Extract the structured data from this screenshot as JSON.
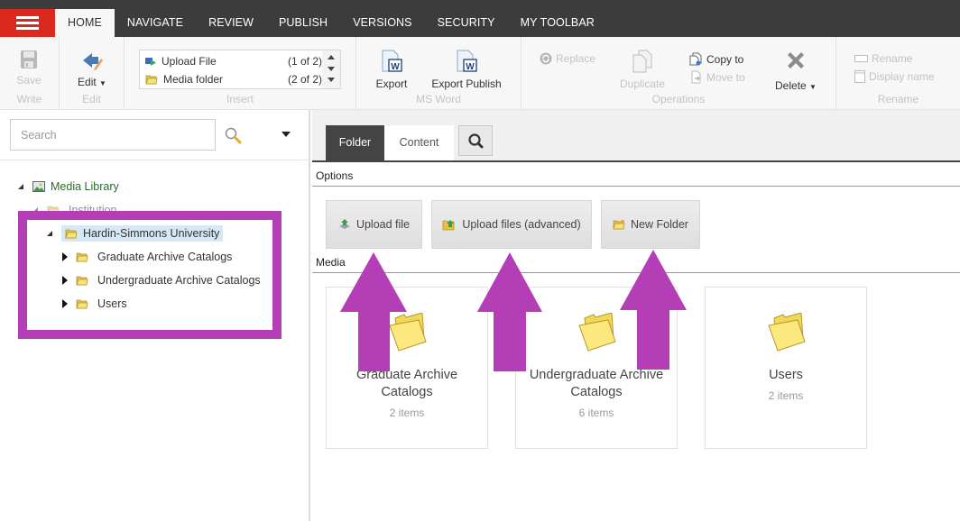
{
  "topbar": {
    "menu_icon": "hamburger-menu-icon",
    "tabs": [
      {
        "label": "HOME",
        "active": true
      },
      {
        "label": "NAVIGATE",
        "active": false
      },
      {
        "label": "REVIEW",
        "active": false
      },
      {
        "label": "PUBLISH",
        "active": false
      },
      {
        "label": "VERSIONS",
        "active": false
      },
      {
        "label": "SECURITY",
        "active": false
      },
      {
        "label": "MY TOOLBAR",
        "active": false
      }
    ]
  },
  "ribbon": {
    "write": {
      "group_label": "Write",
      "save_label": "Save"
    },
    "edit": {
      "group_label": "Edit",
      "edit_label": "Edit"
    },
    "insert": {
      "group_label": "Insert",
      "items": [
        {
          "label": "Upload File",
          "count": "(1 of 2)",
          "icon": "upload-file-icon"
        },
        {
          "label": "Media folder",
          "count": "(2 of 2)",
          "icon": "folder-icon"
        }
      ]
    },
    "msword": {
      "group_label": "MS Word",
      "export_label": "Export",
      "export_publish_label": "Export Publish"
    },
    "operations": {
      "group_label": "Operations",
      "replace_label": "Replace",
      "duplicate_label": "Duplicate",
      "copy_to_label": "Copy to",
      "move_to_label": "Move to",
      "delete_label": "Delete"
    },
    "rename": {
      "group_label": "Rename",
      "rename_label": "Rename",
      "display_name_label": "Display name"
    }
  },
  "left_panel": {
    "search": {
      "placeholder": "Search",
      "value": ""
    },
    "tree": [
      {
        "label": "Media Library",
        "level": 0,
        "expanded": true,
        "icon": "media-library-icon"
      },
      {
        "label": "Institution",
        "level": 1,
        "expanded": true,
        "icon": "folder-icon"
      },
      {
        "label": "Hardin-Simmons University",
        "level": 2,
        "expanded": true,
        "selected": true,
        "icon": "folder-icon"
      },
      {
        "label": "Graduate Archive Catalogs",
        "level": 3,
        "expanded": false,
        "icon": "folder-icon"
      },
      {
        "label": "Undergraduate Archive Catalogs",
        "level": 3,
        "expanded": false,
        "icon": "folder-icon"
      },
      {
        "label": "Users",
        "level": 3,
        "expanded": false,
        "icon": "folder-icon"
      }
    ]
  },
  "right_panel": {
    "tabs": [
      {
        "label": "Folder",
        "active": true
      },
      {
        "label": "Content",
        "active": false
      }
    ],
    "options_label": "Options",
    "options": [
      {
        "label": "Upload file",
        "icon": "upload-file-icon"
      },
      {
        "label": "Upload files (advanced)",
        "icon": "upload-files-advanced-icon"
      },
      {
        "label": "New Folder",
        "icon": "new-folder-icon"
      }
    ],
    "media_label": "Media",
    "media": [
      {
        "title": "Graduate Archive Catalogs",
        "count": "2 items"
      },
      {
        "title": "Undergraduate Archive Catalogs",
        "count": "6 items"
      },
      {
        "title": "Users",
        "count": "2 items"
      }
    ]
  },
  "annotations": {
    "color": "#b43eb6",
    "highlight_box_target": "Hardin-Simmons University subtree",
    "arrows_point_to": [
      "Upload file",
      "Upload files (advanced)",
      "New Folder"
    ]
  }
}
